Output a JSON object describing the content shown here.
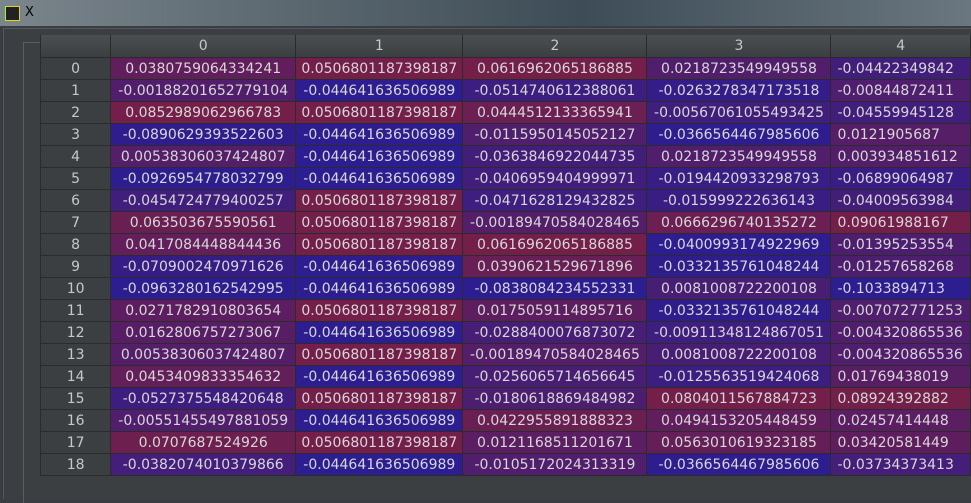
{
  "window": {
    "title": "X"
  },
  "colors": {
    "low": "#2c1d90",
    "high": "#731f4a",
    "mid": "#4b1f6c"
  },
  "table": {
    "columns": [
      "0",
      "1",
      "2",
      "3",
      "4"
    ],
    "rows": [
      {
        "index": "0",
        "cells": [
          "0.0380759064334241",
          "0.0506801187398187",
          "0.0616962065186885",
          "0.0218723549949558",
          "-0.04422349842"
        ]
      },
      {
        "index": "1",
        "cells": [
          "-0.00188201652779104",
          "-0.044641636506989",
          "-0.0514740612388061",
          "-0.0263278347173518",
          "-0.00844872411"
        ]
      },
      {
        "index": "2",
        "cells": [
          "0.0852989062966783",
          "0.0506801187398187",
          "0.0444512133365941",
          "-0.00567061055493425",
          "-0.04559945128"
        ]
      },
      {
        "index": "3",
        "cells": [
          "-0.0890629393522603",
          "-0.044641636506989",
          "-0.0115950145052127",
          "-0.0366564467985606",
          "0.0121905687"
        ]
      },
      {
        "index": "4",
        "cells": [
          "0.00538306037424807",
          "-0.044641636506989",
          "-0.0363846922044735",
          "0.0218723549949558",
          "0.003934851612"
        ]
      },
      {
        "index": "5",
        "cells": [
          "-0.0926954778032799",
          "-0.044641636506989",
          "-0.0406959404999971",
          "-0.0194420933298793",
          "-0.06899064987"
        ]
      },
      {
        "index": "6",
        "cells": [
          "-0.0454724779400257",
          "0.0506801187398187",
          "-0.0471628129432825",
          "-0.015999222636143",
          "-0.04009563984"
        ]
      },
      {
        "index": "7",
        "cells": [
          "0.063503675590561",
          "0.0506801187398187",
          "-0.00189470584028465",
          "0.0666296740135272",
          "0.09061988167"
        ]
      },
      {
        "index": "8",
        "cells": [
          "0.0417084448844436",
          "0.0506801187398187",
          "0.0616962065186885",
          "-0.0400993174922969",
          "-0.01395253554"
        ]
      },
      {
        "index": "9",
        "cells": [
          "-0.0709002470971626",
          "-0.044641636506989",
          "0.0390621529671896",
          "-0.0332135761048244",
          "-0.01257658268"
        ]
      },
      {
        "index": "10",
        "cells": [
          "-0.0963280162542995",
          "-0.044641636506989",
          "-0.0838084234552331",
          "0.0081008722200108",
          "-0.1033894713"
        ]
      },
      {
        "index": "11",
        "cells": [
          "0.0271782910803654",
          "0.0506801187398187",
          "0.0175059114895716",
          "-0.0332135761048244",
          "-0.007072771253"
        ]
      },
      {
        "index": "12",
        "cells": [
          "0.0162806757273067",
          "-0.044641636506989",
          "-0.0288400076873072",
          "-0.00911348124867051",
          "-0.004320865536"
        ]
      },
      {
        "index": "13",
        "cells": [
          "0.00538306037424807",
          "0.0506801187398187",
          "-0.00189470584028465",
          "0.0081008722200108",
          "-0.004320865536"
        ]
      },
      {
        "index": "14",
        "cells": [
          "0.0453409833354632",
          "-0.044641636506989",
          "-0.0256065714656645",
          "-0.0125563519424068",
          "0.01769438019"
        ]
      },
      {
        "index": "15",
        "cells": [
          "-0.0527375548420648",
          "0.0506801187398187",
          "-0.0180618869484982",
          "0.0804011567884723",
          "0.08924392882"
        ]
      },
      {
        "index": "16",
        "cells": [
          "-0.00551455497881059",
          "-0.044641636506989",
          "0.0422955891888323",
          "0.0494153205448459",
          "0.02457414448"
        ]
      },
      {
        "index": "17",
        "cells": [
          "0.0707687524926",
          "0.0506801187398187",
          "0.0121168511201671",
          "0.0563010619323185",
          "0.03420581449"
        ]
      },
      {
        "index": "18",
        "cells": [
          "-0.0382074010379866",
          "-0.044641636506989",
          "-0.0105172024313319",
          "-0.0366564467985606",
          "-0.03734373413"
        ]
      }
    ]
  }
}
